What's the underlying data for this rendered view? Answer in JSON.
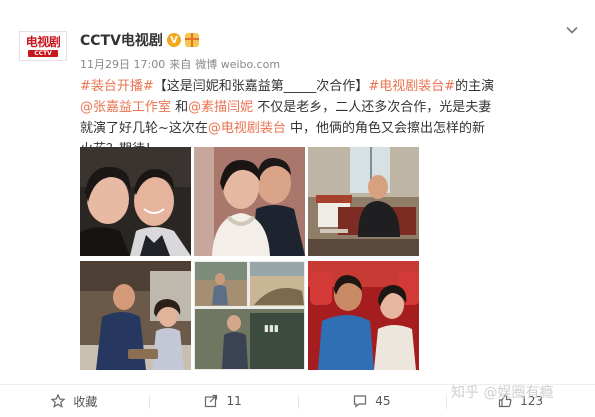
{
  "author": {
    "avatar_top": "电视剧",
    "avatar_bottom": "CCTV",
    "name": "CCTV电视剧",
    "verified_icon": "v-icon",
    "badge_icon": "gift-icon"
  },
  "meta": {
    "date": "11月29日 17:00",
    "source_prefix": "来自",
    "source": "微博 weibo.com"
  },
  "post": {
    "t1": "#装台开播#",
    "t2": "【这是闫妮和张嘉益第_____次合作】",
    "t3": "#电视剧装台#",
    "t4": "的主演",
    "t5": "@张嘉益工作室",
    "t6": " 和",
    "t7": "@素描闫妮",
    "t8": " 不仅是老乡，二人还多次合作，光是夫妻就演了好几轮~这次在",
    "t9": "@电视剧装台",
    "t10": " 中，他俩的角色又会擦出怎样的新火花？期待！"
  },
  "images": [
    {
      "name": "photo-couple-closeup"
    },
    {
      "name": "photo-couple-portrait"
    },
    {
      "name": "photo-man-seated-room"
    },
    {
      "name": "photo-couple-kitchen"
    },
    {
      "name": "photo-stills-collage"
    },
    {
      "name": "photo-couple-theater-seats"
    }
  ],
  "footer": {
    "favorite_label": "收藏",
    "repost_count": "11",
    "comment_count": "45",
    "like_count": "123"
  },
  "watermark": {
    "text": "知乎 @娱圈有瘾"
  },
  "colors": {
    "link": "#eb7350",
    "brand_red": "#c8161d",
    "verified": "#f3a71a"
  }
}
